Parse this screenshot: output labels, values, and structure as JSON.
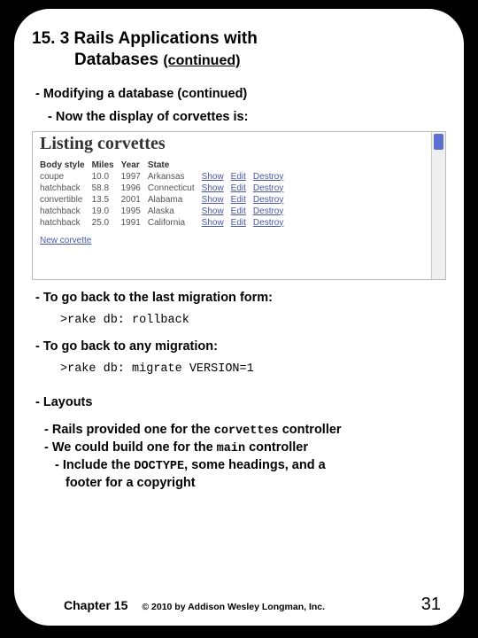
{
  "title": {
    "number": "15. 3",
    "text": "Rails Applications with",
    "text2": "Databases",
    "cont": "(continued)"
  },
  "bullets": {
    "modifying": "- Modifying a database (continued)",
    "display": "- Now the display of corvettes is:",
    "goback_last": "- To go back to the last migration form:",
    "rollback": ">rake db: rollback",
    "goback_any": "- To go back to any migration:",
    "migrate": ">rake db: migrate VERSION=1",
    "layouts_hdr": "- Layouts"
  },
  "layouts": {
    "l1a": "- Rails provided one for the ",
    "l1code": "corvettes",
    "l1b": " controller",
    "l2a": "- We could build one for the ",
    "l2code": "main",
    "l2b": " controller",
    "l3a": "- Include the ",
    "l3code": "DOCTYPE",
    "l3b": ", some headings, and a",
    "l4": "footer for a copyright"
  },
  "shot": {
    "heading": "Listing corvettes",
    "cols": [
      "Body style",
      "Miles",
      "Year",
      "State"
    ],
    "rows": [
      {
        "body": "coupe",
        "miles": "10.0",
        "year": "1997",
        "state": "Arkansas"
      },
      {
        "body": "hatchback",
        "miles": "58.8",
        "year": "1996",
        "state": "Connecticut"
      },
      {
        "body": "convertible",
        "miles": "13.5",
        "year": "2001",
        "state": "Alabama"
      },
      {
        "body": "hatchback",
        "miles": "19.0",
        "year": "1995",
        "state": "Alaska"
      },
      {
        "body": "hatchback",
        "miles": "25.0",
        "year": "1991",
        "state": "California"
      }
    ],
    "actions": {
      "show": "Show",
      "edit": "Edit",
      "destroy": "Destroy"
    },
    "newlink": "New corvette"
  },
  "footer": {
    "chapter": "Chapter 15",
    "copyright": "© 2010 by Addison Wesley Longman, Inc.",
    "page": "31"
  }
}
